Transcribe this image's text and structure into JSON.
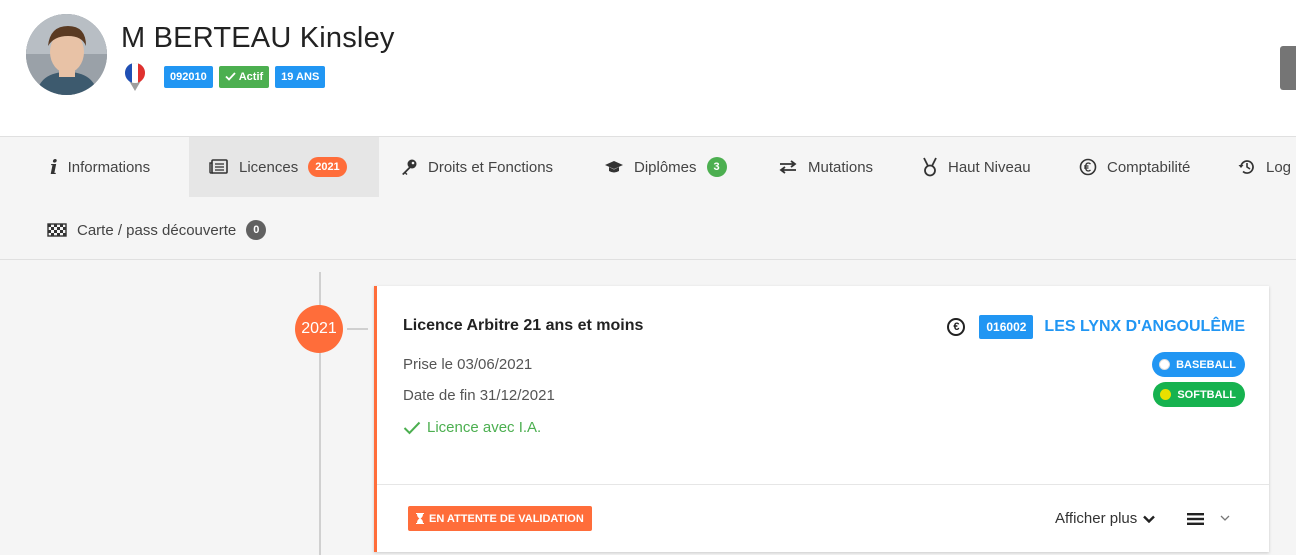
{
  "person": {
    "name": "M BERTEAU Kinsley",
    "code": "092010",
    "status": "Actif",
    "age": "19 ANS"
  },
  "tabs": [
    {
      "label": "Informations",
      "icon": "info-icon"
    },
    {
      "label": "Licences",
      "icon": "newspaper-icon",
      "badge": "2021"
    },
    {
      "label": "Droits et Fonctions",
      "icon": "key-icon"
    },
    {
      "label": "Diplômes",
      "icon": "graduation-cap-icon",
      "badge": "3"
    },
    {
      "label": "Mutations",
      "icon": "exchange-icon"
    },
    {
      "label": "Haut Niveau",
      "icon": "medal-icon"
    },
    {
      "label": "Comptabilité",
      "icon": "euro-icon"
    },
    {
      "label": "Log",
      "icon": "history-icon"
    },
    {
      "label": "Carte / pass découverte",
      "icon": "flag-checkered-icon",
      "badge": "0"
    }
  ],
  "timeline": {
    "year": "2021"
  },
  "license": {
    "title": "Licence Arbitre 21 ans et moins",
    "start": "Prise le 03/06/2021",
    "end": "Date de fin 31/12/2021",
    "insurance": "Licence avec I.A.",
    "club_code": "016002",
    "club_name": "LES LYNX D'ANGOULÊME",
    "sports": [
      "BASEBALL",
      "SOFTBALL"
    ],
    "status": "EN ATTENTE DE VALIDATION",
    "more_label": "Afficher plus"
  },
  "colors": {
    "accent": "#ff6d3a",
    "primary": "#2196f3",
    "success": "#4caf50"
  }
}
